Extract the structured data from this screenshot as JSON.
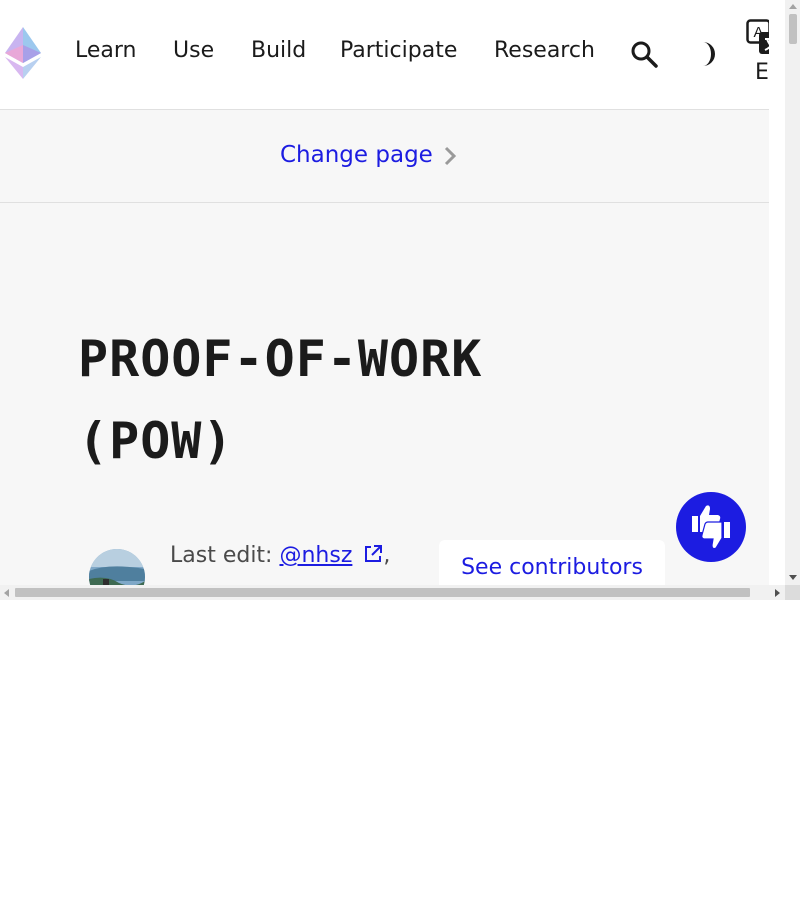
{
  "header": {
    "nav": [
      "Learn",
      "Use",
      "Build",
      "Participate",
      "Research"
    ],
    "language": "EN",
    "icons": {
      "logo": "ethereum-logo-icon",
      "search": "search-icon",
      "theme": "dark-mode-icon",
      "language": "translate-icon"
    }
  },
  "change_page": {
    "label": "Change page"
  },
  "page": {
    "title": "Proof-of-work (PoW)",
    "last_edit_prefix": "Last edit: ",
    "last_edit_author": "@nhsz",
    "last_edit_suffix": ",",
    "see_contributors": "See contributors"
  },
  "feedback": {
    "icon": "thumbs-up-down-icon"
  },
  "colors": {
    "accent": "#1c1ce1",
    "background": "#f7f7f7",
    "text": "#1b1b1b"
  }
}
